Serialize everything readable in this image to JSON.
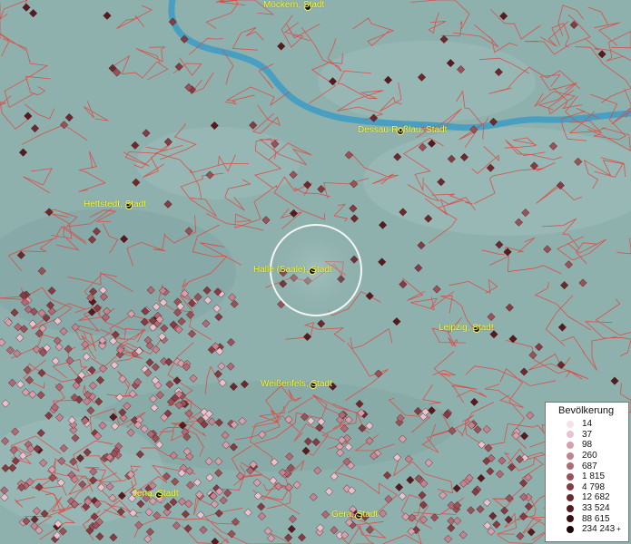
{
  "map": {
    "cities": [
      {
        "id": "moeckern",
        "label": "Möckern, Stadt"
      },
      {
        "id": "dessau",
        "label": "Dessau-Roßlau, Stadt"
      },
      {
        "id": "hettstedt",
        "label": "Hettstedt, Stadt"
      },
      {
        "id": "halle",
        "label": "Halle (Saale), Stadt"
      },
      {
        "id": "leipzig",
        "label": "Leipzig, Stadt"
      },
      {
        "id": "weissenfels",
        "label": "Weißenfels, Stadt"
      },
      {
        "id": "jena",
        "label": "Jena, Stadt"
      },
      {
        "id": "gera",
        "label": "Gera, Stadt"
      }
    ],
    "selected_city": "halle"
  },
  "legend": {
    "title": "Bevölkerung",
    "items": [
      {
        "label": "14",
        "color": "#f6e1ea"
      },
      {
        "label": "37",
        "color": "#e8c2cc"
      },
      {
        "label": "98",
        "color": "#d6a1ad"
      },
      {
        "label": "260",
        "color": "#c4838f"
      },
      {
        "label": "687",
        "color": "#b06a75"
      },
      {
        "label": "1 815",
        "color": "#9a5259"
      },
      {
        "label": "4 798",
        "color": "#843d43"
      },
      {
        "label": "12 682",
        "color": "#6d2a2e"
      },
      {
        "label": "33 524",
        "color": "#561b1e"
      },
      {
        "label": "88 615",
        "color": "#3b0f11"
      },
      {
        "label": "234 243",
        "color": "#1e0607",
        "plus": "+"
      }
    ]
  },
  "colors": {
    "background": "#8fb1ae",
    "borders": "#e0463f",
    "river": "#3d9cc6",
    "label": "#ffff33"
  }
}
